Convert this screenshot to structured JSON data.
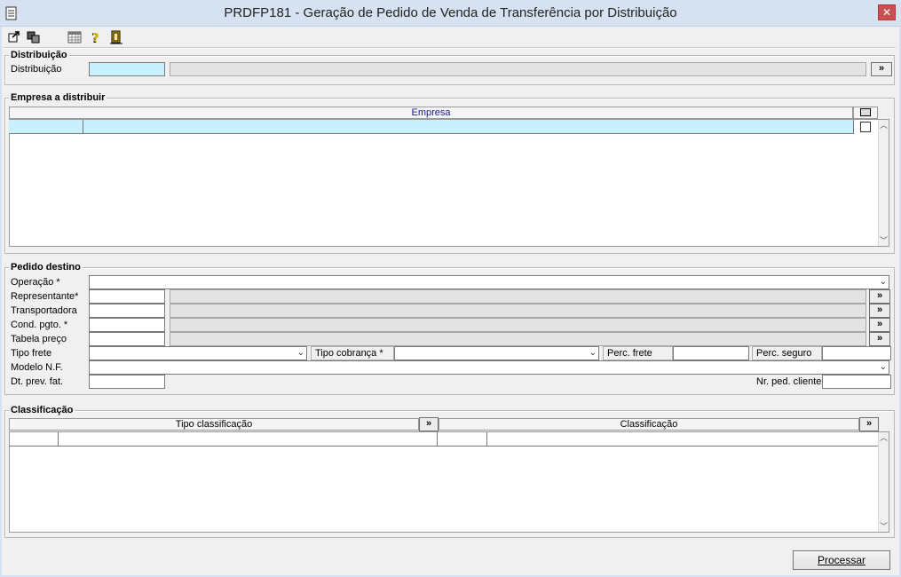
{
  "window": {
    "title": "PRDFP181 - Geração de Pedido de Venda de Transferência por Distribuição",
    "close_glyph": "✕",
    "colors": {
      "title_bar": "#d6e2f1",
      "close": "#c75050",
      "highlight_input": "#c8f0ff"
    }
  },
  "toolbar": {
    "icons": [
      "exit-icon",
      "copy-icon",
      "calendar-grid-icon",
      "help-icon",
      "door-exit-icon"
    ]
  },
  "distribuicao": {
    "group_title": "Distribuição",
    "label": "Distribuição",
    "code_value": "",
    "description_value": "",
    "lookup_label": "»"
  },
  "empresa": {
    "group_title": "Empresa a distribuir",
    "column_header": "Empresa",
    "rows": [
      {
        "code": "",
        "name": ""
      }
    ]
  },
  "pedido": {
    "group_title": "Pedido destino",
    "operacao_label": "Operação *",
    "representante_label": "Representante*",
    "transportadora_label": "Transportadora",
    "cond_pgto_label": "Cond. pgto. *",
    "tabela_preco_label": "Tabela preço",
    "tipo_frete_label": "Tipo frete",
    "tipo_cobranca_label": "Tipo cobrança *",
    "perc_frete_label": "Perc. frete",
    "perc_seguro_label": "Perc. seguro",
    "modelo_nf_label": "Modelo N.F.",
    "dt_prev_fat_label": "Dt. prev. fat.",
    "nr_ped_cliente_label": "Nr. ped. cliente",
    "lookup_label": "»"
  },
  "classificacao": {
    "group_title": "Classificação",
    "col_tipo": "Tipo classificação",
    "col_class": "Classificação",
    "lookup_label": "»"
  },
  "actions": {
    "process_label": "Processar"
  }
}
